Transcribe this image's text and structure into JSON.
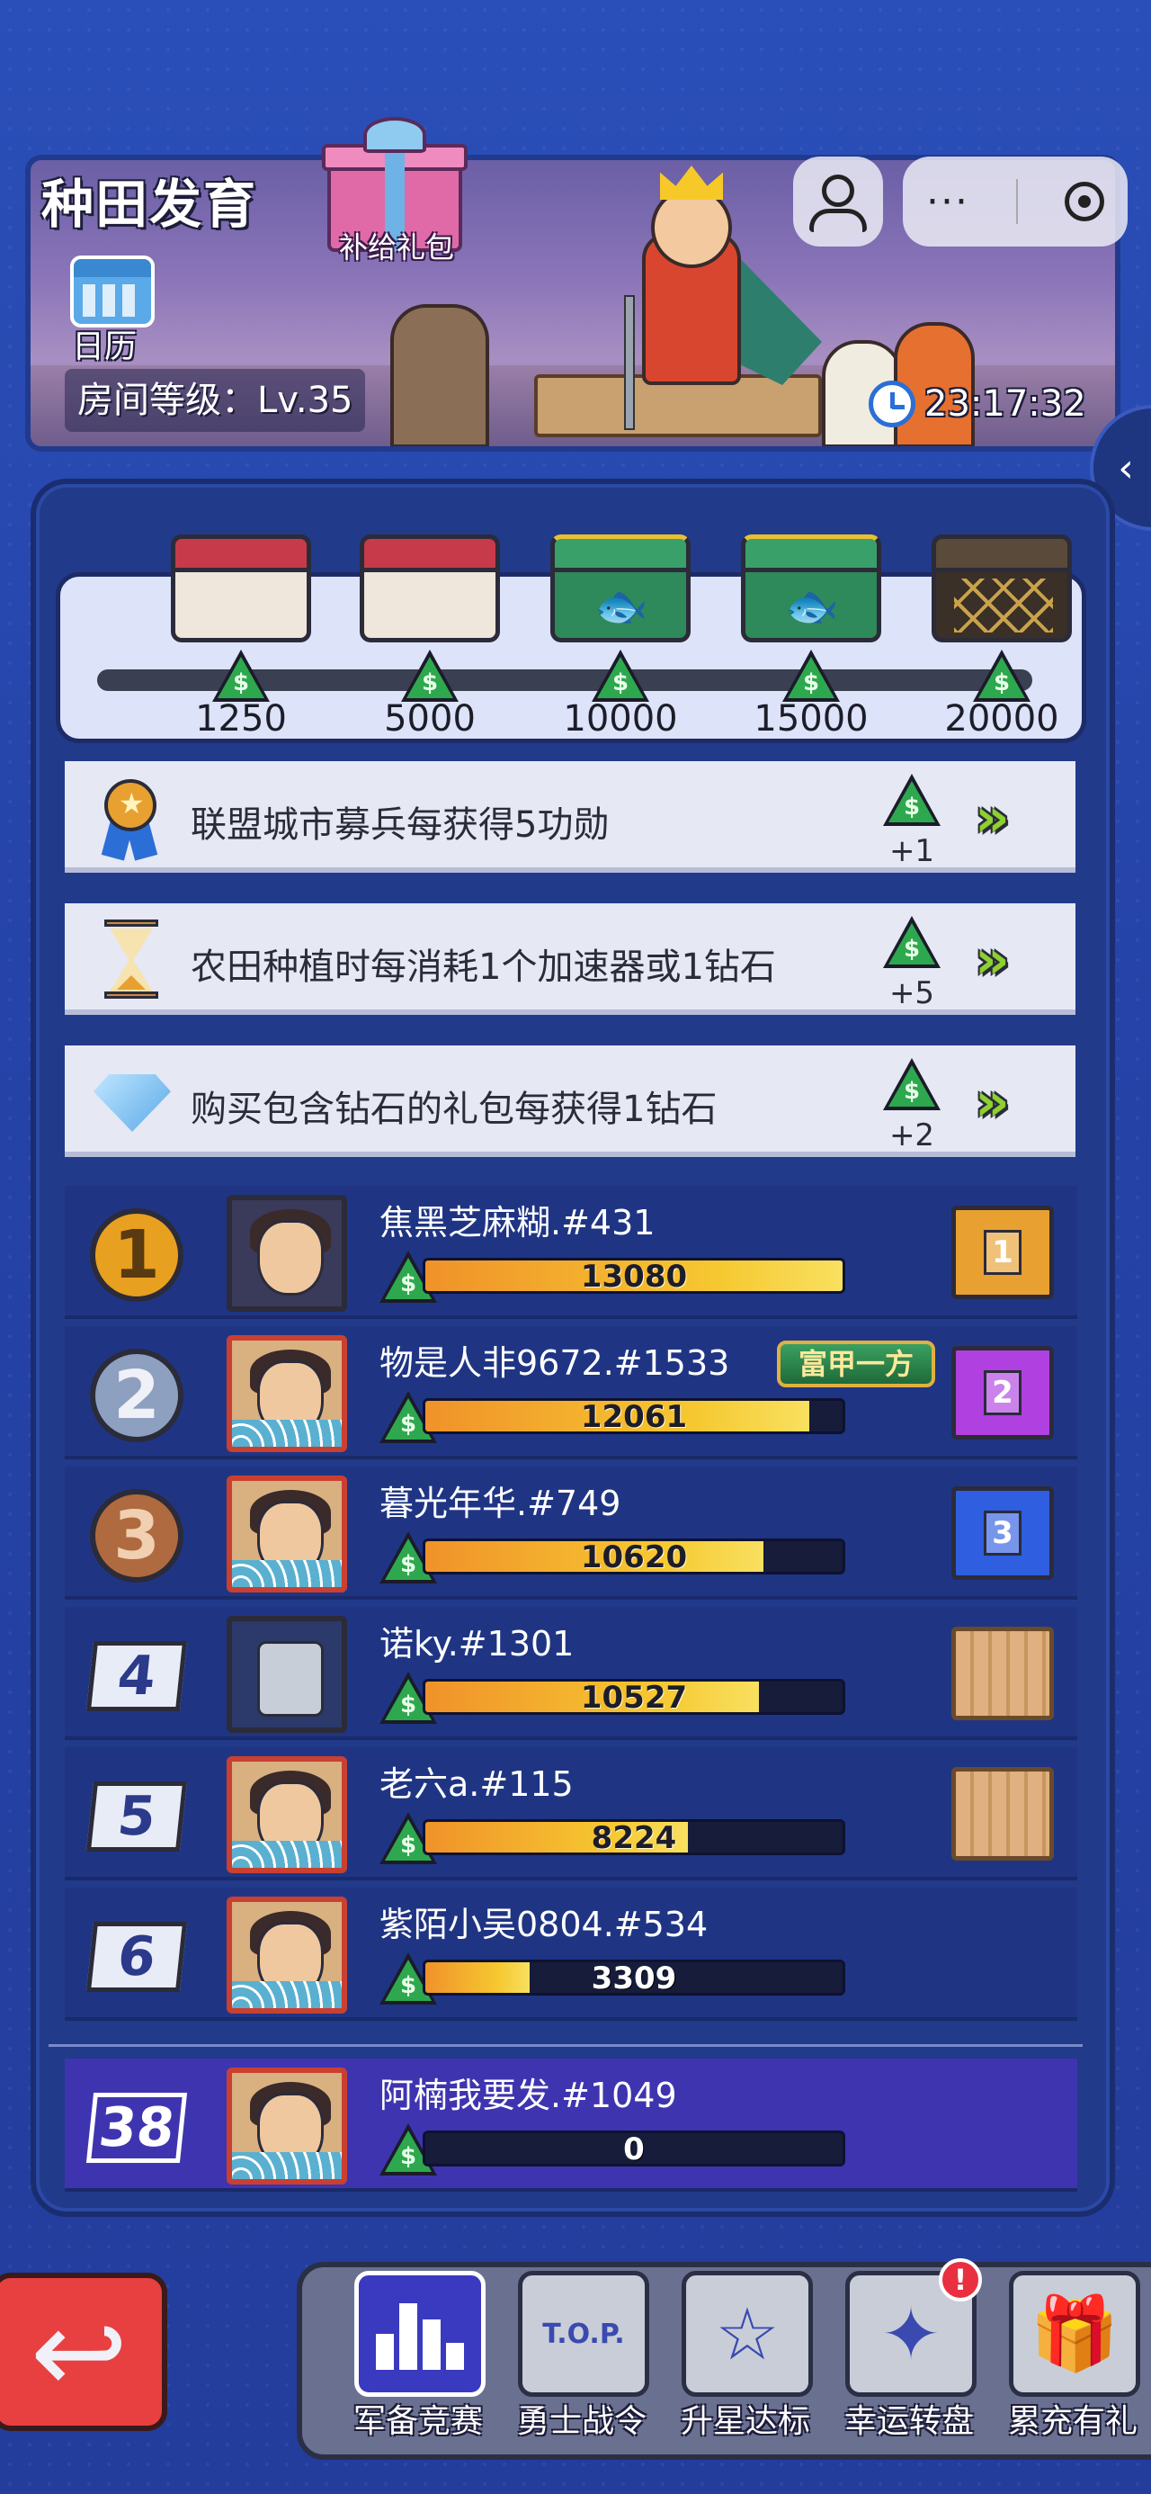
{
  "header": {
    "title": "种田发育",
    "gift_label": "补给礼包",
    "calendar_label": "日历",
    "room_level": "房间等级：Lv.35",
    "timer": "23:17:32"
  },
  "system": {
    "more_label": "···",
    "side_tab_arrow": "‹"
  },
  "reward_track": {
    "milestones": [
      {
        "value": "1250",
        "chest": "white"
      },
      {
        "value": "5000",
        "chest": "white"
      },
      {
        "value": "10000",
        "chest": "green"
      },
      {
        "value": "15000",
        "chest": "green"
      },
      {
        "value": "20000",
        "chest": "black"
      }
    ],
    "progress_fraction": 0
  },
  "coin_symbol": "$",
  "tasks": [
    {
      "text": "联盟城市募兵每获得5功勋",
      "reward": "+1",
      "icon": "medal-icon"
    },
    {
      "text": "农田种植时每消耗1个加速器或1钻石",
      "reward": "+5",
      "icon": "hourglass-icon"
    },
    {
      "text": "购买包含钻石的礼包每获得1钻石",
      "reward": "+2",
      "icon": "diamond-icon"
    }
  ],
  "go_arrow": "»",
  "ranking": [
    {
      "rank": "1",
      "name": "焦黑芝麻糊.#431",
      "score": "13080",
      "fill": 1.0,
      "reward": "1"
    },
    {
      "rank": "2",
      "name": "物是人非9672.#1533",
      "score": "12061",
      "fill": 0.92,
      "reward": "2",
      "title_badge": "富甲一方"
    },
    {
      "rank": "3",
      "name": "暮光年华.#749",
      "score": "10620",
      "fill": 0.81,
      "reward": "3"
    },
    {
      "rank": "4",
      "name": "诺ky.#1301",
      "score": "10527",
      "fill": 0.8
    },
    {
      "rank": "5",
      "name": "老六a.#115",
      "score": "8224",
      "fill": 0.63
    },
    {
      "rank": "6",
      "name": "紫陌小吴0804.#534",
      "score": "3309",
      "fill": 0.25
    }
  ],
  "self": {
    "rank": "38",
    "name": "阿楠我要发.#1049",
    "score": "0",
    "fill": 0
  },
  "back_arrow": "↩",
  "nav": [
    {
      "label": "军备竞赛",
      "icon": "bar-chart-icon",
      "active": true
    },
    {
      "label": "勇士战令",
      "icon": "top-ticket-icon",
      "glyph": "T.O.P."
    },
    {
      "label": "升星达标",
      "icon": "star-up-icon",
      "glyph": "☆"
    },
    {
      "label": "幸运转盘",
      "icon": "lucky-box-icon",
      "glyph": "✦",
      "alert": "!"
    },
    {
      "label": "累充有礼",
      "icon": "gift-icon",
      "glyph": "🎁"
    }
  ],
  "colors": {
    "background": "#2543a8",
    "panel": "#213a8a",
    "progress_fill": "#f6c830",
    "self_row": "#3f34b0"
  }
}
